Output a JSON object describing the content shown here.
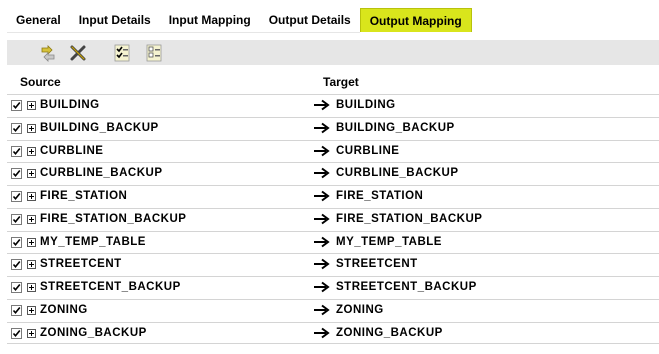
{
  "tabs": [
    "General",
    "Input Details",
    "Input Mapping",
    "Output Details",
    "Output Mapping"
  ],
  "active_tab": "Output Mapping",
  "accent_color": "#d9e51c",
  "toolbar": {
    "icons": [
      "auto-map-icon",
      "delete-icon",
      "check-all-icon",
      "uncheck-all-icon"
    ]
  },
  "columns": {
    "source": "Source",
    "target": "Target"
  },
  "rows": [
    {
      "checked": true,
      "source": "BUILDING",
      "target": "BUILDING"
    },
    {
      "checked": true,
      "source": "BUILDING_BACKUP",
      "target": "BUILDING_BACKUP"
    },
    {
      "checked": true,
      "source": "CURBLINE",
      "target": "CURBLINE"
    },
    {
      "checked": true,
      "source": "CURBLINE_BACKUP",
      "target": "CURBLINE_BACKUP"
    },
    {
      "checked": true,
      "source": "FIRE_STATION",
      "target": "FIRE_STATION"
    },
    {
      "checked": true,
      "source": "FIRE_STATION_BACKUP",
      "target": "FIRE_STATION_BACKUP"
    },
    {
      "checked": true,
      "source": "MY_TEMP_TABLE",
      "target": "MY_TEMP_TABLE"
    },
    {
      "checked": true,
      "source": "STREETCENT",
      "target": "STREETCENT"
    },
    {
      "checked": true,
      "source": "STREETCENT_BACKUP",
      "target": "STREETCENT_BACKUP"
    },
    {
      "checked": true,
      "source": "ZONING",
      "target": "ZONING"
    },
    {
      "checked": true,
      "source": "ZONING_BACKUP",
      "target": "ZONING_BACKUP"
    }
  ]
}
